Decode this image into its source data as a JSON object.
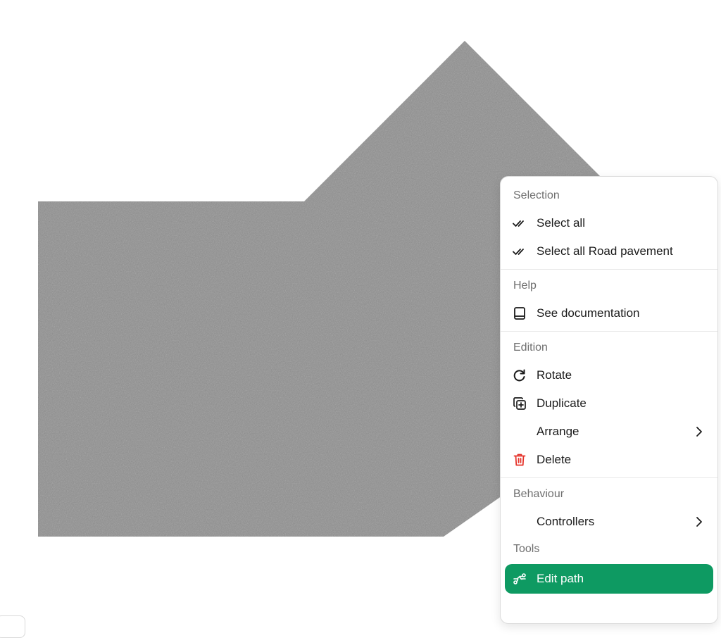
{
  "colors": {
    "pavement": "#8a8a8a",
    "accent": "#0e9a62",
    "danger": "#e5332a"
  },
  "canvas": {
    "shape_name": "Road pavement"
  },
  "context_menu": {
    "sections": {
      "selection": "Selection",
      "help": "Help",
      "edition": "Edition",
      "behaviour": "Behaviour",
      "tools": "Tools"
    },
    "items": {
      "select_all": {
        "label": "Select all",
        "icon": "double-check-icon"
      },
      "select_all_type": {
        "label": "Select all Road pavement",
        "icon": "double-check-icon"
      },
      "see_documentation": {
        "label": "See documentation",
        "icon": "book-icon"
      },
      "rotate": {
        "label": "Rotate",
        "icon": "rotate-icon"
      },
      "duplicate": {
        "label": "Duplicate",
        "icon": "duplicate-icon"
      },
      "arrange": {
        "label": "Arrange",
        "icon": "chevron-right-icon"
      },
      "delete": {
        "label": "Delete",
        "icon": "trash-icon"
      },
      "controllers": {
        "label": "Controllers",
        "icon": "chevron-right-icon"
      },
      "edit_path": {
        "label": "Edit path",
        "icon": "path-edit-icon"
      }
    }
  }
}
